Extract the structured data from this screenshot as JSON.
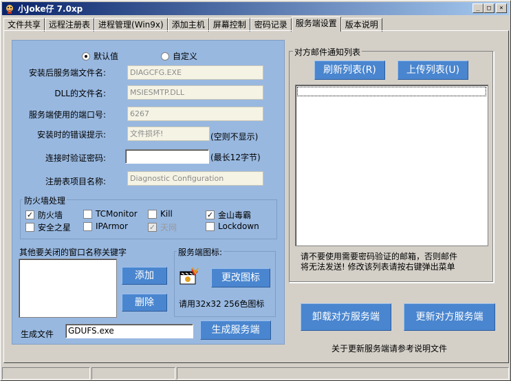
{
  "window": {
    "title": "小Joke仔 7.0xp"
  },
  "tabs": [
    "文件共享",
    "远程注册表",
    "进程管理(Win9x)",
    "添加主机",
    "屏幕控制",
    "密码记录",
    "服务端设置",
    "版本说明"
  ],
  "options": {
    "default_label": "默认值",
    "custom_label": "自定义",
    "selected": "default"
  },
  "fields": {
    "filename_label": "安装后服务端文件名:",
    "filename_value": "DIAGCFG.EXE",
    "dll_label": "DLL的文件名:",
    "dll_value": "MSIESMTP.DLL",
    "port_label": "服务端使用的端口号:",
    "port_value": "6267",
    "error_label": "安装时的错误提示:",
    "error_value": "文件损坏!",
    "error_hint": "(空则不显示)",
    "password_label": "连接时验证密码:",
    "password_value": "",
    "password_hint": "(最长12字节)",
    "registry_label": "注册表项目名称:",
    "registry_value": "Diagnostic Configuration"
  },
  "firewall": {
    "title": "防火墙处理",
    "items": [
      {
        "label": "防火墙",
        "checked": true,
        "disabled": false
      },
      {
        "label": "TCMonitor",
        "checked": false,
        "disabled": false
      },
      {
        "label": "Kill",
        "checked": false,
        "disabled": false
      },
      {
        "label": "金山毒霸",
        "checked": true,
        "disabled": false
      },
      {
        "label": "安全之星",
        "checked": false,
        "disabled": false
      },
      {
        "label": "IPArmor",
        "checked": false,
        "disabled": false
      },
      {
        "label": "天网",
        "checked": true,
        "disabled": true
      },
      {
        "label": "Lockdown",
        "checked": false,
        "disabled": false
      }
    ]
  },
  "windows_keywords": {
    "label": "其他要关闭的窗口名称关键字",
    "add_label": "添加",
    "delete_label": "删除"
  },
  "server_icon": {
    "title": "服务端图标:",
    "change_label": "更改图标",
    "hint": "请用32x32 256色图标"
  },
  "generate": {
    "label": "生成文件",
    "value": "GDUFS.exe",
    "button_label": "生成服务端"
  },
  "mail_list": {
    "title": "对方邮件通知列表",
    "refresh_label": "刷新列表(R)",
    "upload_label": "上传列表(U)",
    "note": "请不要使用需要密码验证的邮箱，否则邮件\n将无法发送! 修改该列表请按右键弹出菜单"
  },
  "actions": {
    "uninstall_label": "卸载对方服务端",
    "update_label": "更新对方服务端",
    "note": "关于更新服务端请参考说明文件"
  },
  "icons": [
    "app-icon",
    "minimize-icon",
    "maximize-icon",
    "close-icon",
    "server-icon"
  ],
  "colors": {
    "panel": "#98b8e0",
    "button": "#4a86cf",
    "title_start": "#0a246a",
    "title_end": "#a6caf0"
  }
}
